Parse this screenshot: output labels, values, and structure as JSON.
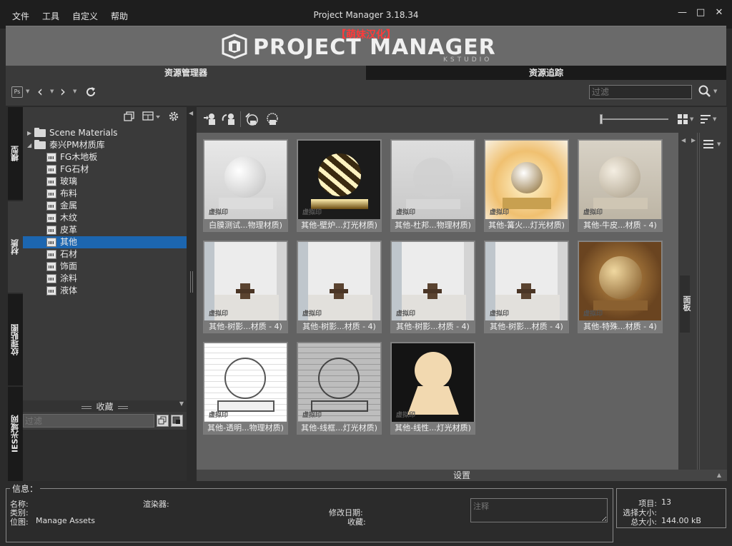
{
  "window": {
    "title": "Project Manager 3.18.34",
    "menu": [
      "文件",
      "工具",
      "自定义",
      "帮助"
    ],
    "controls": [
      "—",
      "□",
      "✕"
    ]
  },
  "banner": {
    "localization": "【萌妹汉化】",
    "brand": "PROJECT MANAGER",
    "studio": "KSTUDIO"
  },
  "tabs": {
    "asset_browser": "资源管理器",
    "asset_tracking": "资源追踪"
  },
  "toolbar": {
    "ps_label": "Ps",
    "filter_placeholder": "过滤"
  },
  "side_tabs": [
    "模型",
    "材质",
    "纹理贴图",
    "IES光域网"
  ],
  "tree": {
    "roots": [
      {
        "label": "Scene Materials",
        "expanded": false
      },
      {
        "label": "泰兴PM材质库",
        "expanded": true
      }
    ],
    "children": [
      "FG木地板",
      "FG石材",
      "玻璃",
      "布料",
      "金属",
      "木纹",
      "皮革",
      "其他",
      "石材",
      "饰面",
      "涂料",
      "液体"
    ],
    "selected": "其他"
  },
  "favorites": {
    "title": "收藏",
    "filter_placeholder": "过滤"
  },
  "thumbnails": [
    {
      "caption": "白膜测试...物理材质)",
      "style": "white"
    },
    {
      "caption": "其他-壁炉...灯光材质)",
      "style": "dark"
    },
    {
      "caption": "其他-杜邦...物理材质)",
      "style": "faint"
    },
    {
      "caption": "其他-篝火...灯光材质)",
      "style": "fire"
    },
    {
      "caption": "其他-牛皮...材质 - 4)",
      "style": "beige"
    },
    {
      "caption": "其他-树影...材质 - 4)",
      "style": "room"
    },
    {
      "caption": "其他-树影...材质 - 4)",
      "style": "room"
    },
    {
      "caption": "其他-树影...材质 - 4)",
      "style": "room"
    },
    {
      "caption": "其他-树影...材质 - 4)",
      "style": "room"
    },
    {
      "caption": "其他-特殊...材质 - 4)",
      "style": "gold"
    },
    {
      "caption": "其他-透明...物理材质)",
      "style": "wire"
    },
    {
      "caption": "其他-线框...灯光材质)",
      "style": "wiredark"
    },
    {
      "caption": "其他-线性...灯光材质)",
      "style": "flat"
    }
  ],
  "watermark": "虚拟印",
  "right_strip_label": "面板",
  "settings_label": "设置",
  "info": {
    "title": "信息：",
    "name_label": "名称:",
    "category_label": "类别:",
    "location_label": "位图:",
    "location_value": "Manage Assets",
    "renderer_label": "渲染器:",
    "modified_label": "修改日期:",
    "favorites_label": "收藏:",
    "notes_placeholder": "注释"
  },
  "stats": {
    "items_label": "项目:",
    "items_value": "13",
    "selected_label": "选择大小:",
    "total_label": "总大小:",
    "total_value": "144.00 kB"
  }
}
